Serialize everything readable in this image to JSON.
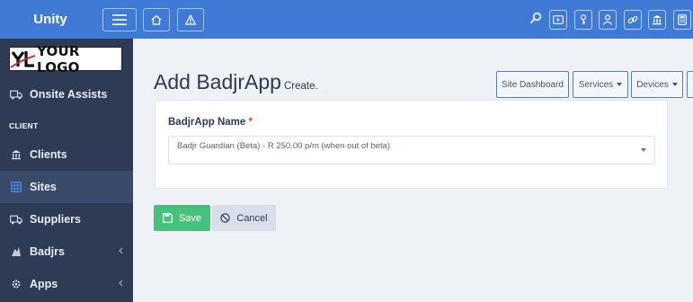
{
  "header": {
    "brand": "Unity"
  },
  "sidebar": {
    "logo_text": "YOUR LOGO",
    "logo_mark": "YL",
    "section_label": "CLIENT",
    "items": [
      {
        "label": "Onsite Assists",
        "icon": "truck-icon"
      },
      {
        "label": "Clients",
        "icon": "bank-icon"
      },
      {
        "label": "Sites",
        "icon": "grid-icon",
        "active": true
      },
      {
        "label": "Suppliers",
        "icon": "truck-icon"
      },
      {
        "label": "Badjrs",
        "icon": "badge-icon",
        "expandable": true
      },
      {
        "label": "Apps",
        "icon": "gear-icon",
        "expandable": true
      }
    ]
  },
  "page": {
    "title": "Add BadjrApp",
    "subtitle": "Create.",
    "buttons": {
      "site_dashboard": "Site Dashboard",
      "services": "Services",
      "devices": "Devices"
    }
  },
  "form": {
    "label": "BadjrApp Name",
    "required_mark": "*",
    "selected_value": "Badjr Guardian (Beta) - R 250.00 p/m (when out of beta)",
    "save_label": "Save",
    "cancel_label": "Cancel"
  },
  "colors": {
    "topbar": "#3f7ad6",
    "sidebar": "#2d3b55",
    "save": "#48c17d",
    "cancel": "#d8dfe9"
  }
}
